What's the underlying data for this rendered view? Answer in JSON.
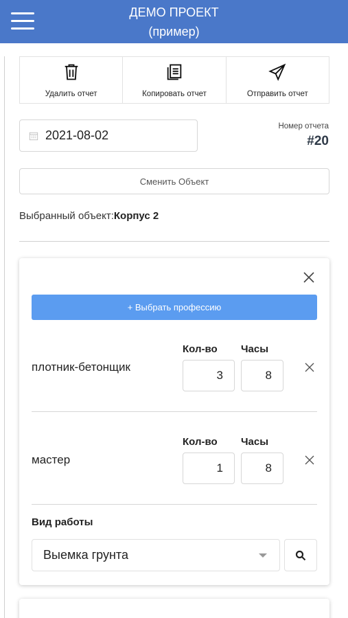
{
  "header": {
    "title": "ДЕМО ПРОЕКТ",
    "subtitle": "(пример)",
    "menu_icon": "hamburger-menu-icon",
    "color": "#4a78c9"
  },
  "actions": [
    {
      "label": "Удалить отчет",
      "icon": "trash-icon"
    },
    {
      "label": "Копировать отчет",
      "icon": "copy-icon"
    },
    {
      "label": "Отправить отчет",
      "icon": "send-icon"
    }
  ],
  "report": {
    "date": "2021-08-02",
    "number_label": "Номер отчета",
    "number": "#20"
  },
  "object": {
    "change_label": "Сменить Объект",
    "selected_prefix": "Выбранный объект:",
    "selected_value": "Корпус 2"
  },
  "card": {
    "choose_label": "+ Выбрать профессию",
    "accent": "#5b9cf0",
    "qty_header": "Кол-во",
    "hours_header": "Часы",
    "professions": [
      {
        "name": "плотник-бетонщик",
        "qty": "3",
        "hours": "8"
      },
      {
        "name": "мастер",
        "qty": "1",
        "hours": "8"
      }
    ],
    "work_type_label": "Вид работы",
    "work_type_value": "Выемка грунта"
  }
}
